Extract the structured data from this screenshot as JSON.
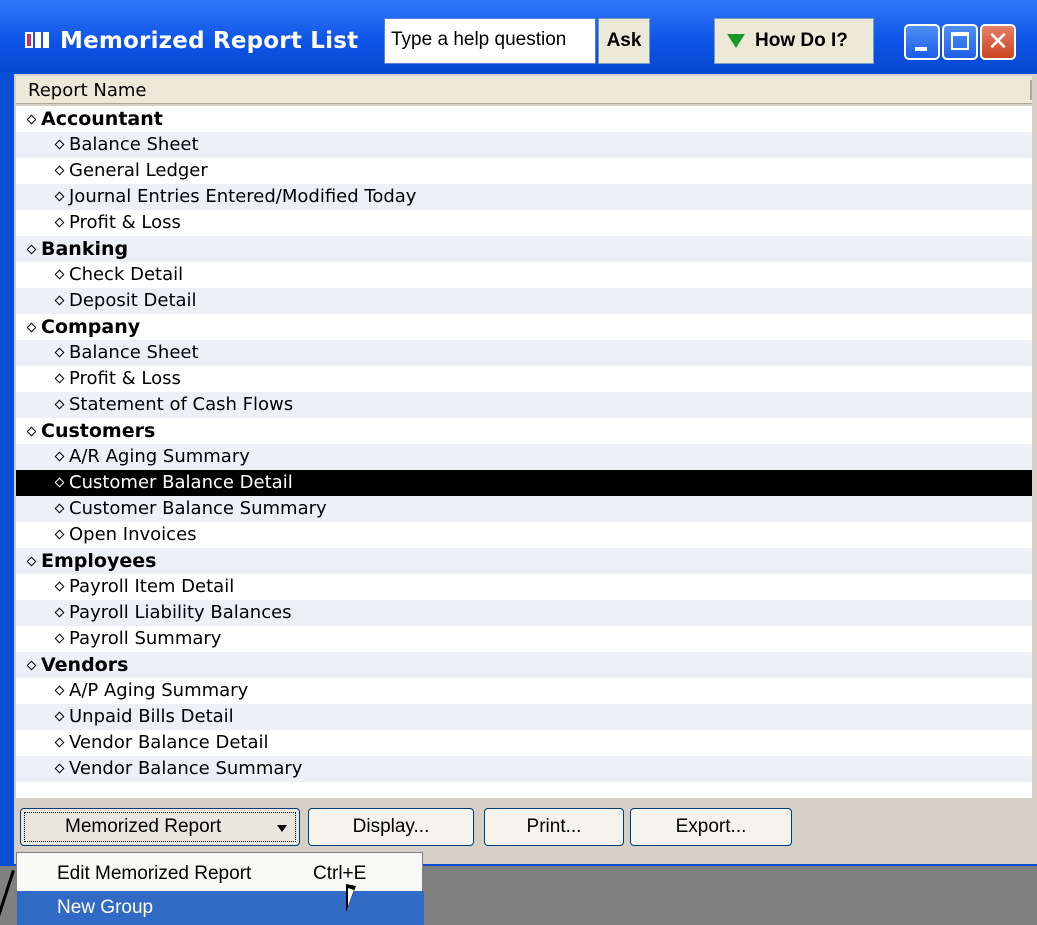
{
  "window": {
    "title": "Memorized Report List",
    "help_placeholder": "Type a help question",
    "ask_label": "Ask",
    "howdoi_label": "How Do I?",
    "close_glyph": "✕"
  },
  "list": {
    "column_header": "Report Name",
    "selected_index": 14,
    "rows": [
      {
        "label": "Accountant",
        "group": true
      },
      {
        "label": "Balance Sheet",
        "group": false
      },
      {
        "label": "General Ledger",
        "group": false
      },
      {
        "label": "Journal Entries Entered/Modified Today",
        "group": false
      },
      {
        "label": "Profit & Loss",
        "group": false
      },
      {
        "label": "Banking",
        "group": true
      },
      {
        "label": "Check Detail",
        "group": false
      },
      {
        "label": "Deposit Detail",
        "group": false
      },
      {
        "label": "Company",
        "group": true
      },
      {
        "label": "Balance Sheet",
        "group": false
      },
      {
        "label": "Profit & Loss",
        "group": false
      },
      {
        "label": "Statement of Cash Flows",
        "group": false
      },
      {
        "label": "Customers",
        "group": true
      },
      {
        "label": "A/R Aging Summary",
        "group": false
      },
      {
        "label": "Customer Balance Detail",
        "group": false
      },
      {
        "label": "Customer Balance Summary",
        "group": false
      },
      {
        "label": "Open Invoices",
        "group": false
      },
      {
        "label": "Employees",
        "group": true
      },
      {
        "label": "Payroll Item Detail",
        "group": false
      },
      {
        "label": "Payroll Liability Balances",
        "group": false
      },
      {
        "label": "Payroll Summary",
        "group": false
      },
      {
        "label": "Vendors",
        "group": true
      },
      {
        "label": "A/P Aging Summary",
        "group": false
      },
      {
        "label": "Unpaid Bills Detail",
        "group": false
      },
      {
        "label": "Vendor Balance Detail",
        "group": false
      },
      {
        "label": "Vendor Balance Summary",
        "group": false
      }
    ]
  },
  "buttons": {
    "memorized_report": "Memorized Report",
    "display": "Display...",
    "print": "Print...",
    "export": "Export..."
  },
  "menu": {
    "items": [
      {
        "label": "Edit Memorized Report",
        "shortcut": "Ctrl+E",
        "highlighted": false
      },
      {
        "label": "New Group",
        "shortcut": "",
        "highlighted": true
      }
    ]
  },
  "colors": {
    "titlebar": "#0c53e6",
    "selection": "#000000",
    "menu_highlight": "#316ac5"
  }
}
